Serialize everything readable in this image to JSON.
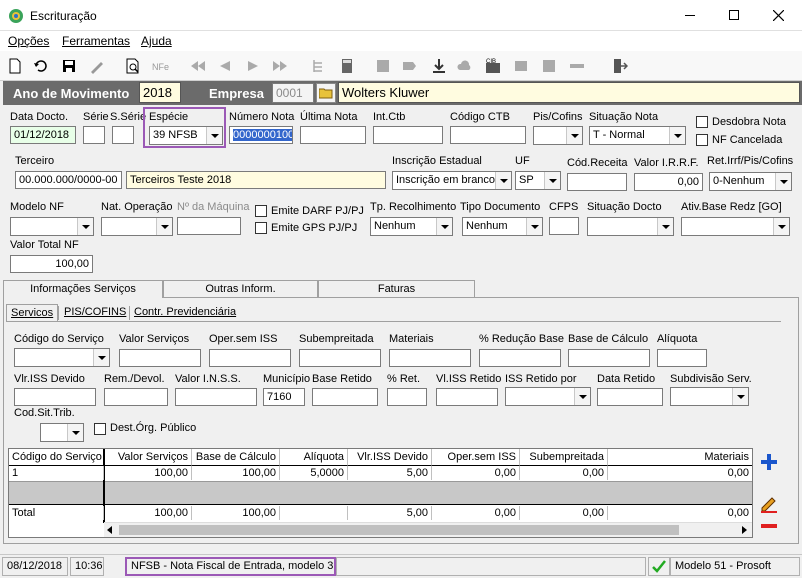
{
  "window": {
    "title": "Escrituração"
  },
  "menu": [
    "Opções",
    "Ferramentas",
    "Ajuda"
  ],
  "header": {
    "ano_label": "Ano de Movimento",
    "ano_value": "2018",
    "empresa_label": "Empresa",
    "empresa_code": "0001",
    "empresa_name": "Wolters Kluwer"
  },
  "row1": {
    "data_docto_label": "Data Docto.",
    "data_docto": "01/12/2018",
    "serie_label": "Série",
    "s_serie_label": "S.Série",
    "especie_label": "Espécie",
    "especie": "39 NFSB",
    "numero_label": "Número Nota",
    "numero": "0000000100",
    "ultima_label": "Última Nota",
    "intctb_label": "Int.Ctb",
    "codctb_label": "Código CTB",
    "piscofins_label": "Pis/Cofins",
    "situacao_label": "Situação Nota",
    "situacao": "T - Normal",
    "desdobra_label": "Desdobra Nota",
    "nfcancelada_label": "NF Cancelada"
  },
  "row2": {
    "terceiro_label": "Terceiro",
    "terceiro_doc": "00.000.000/0000-00",
    "terceiro_nome": "Terceiros Teste 2018",
    "inscricao_label": "Inscrição Estadual",
    "inscricao": "Inscrição em branco",
    "uf_label": "UF",
    "uf": "SP",
    "codreceita_label": "Cód.Receita",
    "irrf_label": "Valor I.R.R.F.",
    "irrf": "0,00",
    "ret_label": "Ret.Irrf/Pis/Cofins",
    "ret": "0-Nenhum"
  },
  "row3": {
    "modelo_label": "Modelo NF",
    "natop_label": "Nat. Operação",
    "maquina_label": "Nº da Máquina",
    "darf_label": "Emite DARF PJ/PJ",
    "gps_label": "Emite GPS PJ/PJ",
    "tprec_label": "Tp. Recolhimento",
    "tprec": "Nenhum",
    "tpdoc_label": "Tipo Documento",
    "tpdoc": "Nenhum",
    "cfps_label": "CFPS",
    "sitdocto_label": "Situação Docto",
    "ativ_label": "Ativ.Base Redz [GO]"
  },
  "row4": {
    "valortotal_label": "Valor Total NF",
    "valortotal": "100,00"
  },
  "tabs": [
    "Informações Serviços",
    "Outras Inform.",
    "Faturas"
  ],
  "subtabs": [
    "Servicos",
    "PIS/COFINS",
    "Contr. Previdenciária"
  ],
  "serv1": {
    "codserv_label": "Código do Serviço",
    "valserv_label": "Valor Serviços",
    "opersem_label": "Oper.sem ISS",
    "subempreitada_label": "Subempreitada",
    "materiais_label": "Materiais",
    "reducao_label": "% Redução Base",
    "basecalc_label": "Base de Cálculo",
    "aliquota_label": "Alíquota"
  },
  "serv2": {
    "vliss_label": "Vlr.ISS Devido",
    "remdevol_label": "Rem./Devol.",
    "valinss_label": "Valor I.N.S.S.",
    "municipio_label": "Município",
    "municipio": "7160",
    "baseretido_label": "Base Retido",
    "pret_label": "% Ret.",
    "vlissret_label": "Vl.ISS Retido",
    "issretpor_label": "ISS Retido por",
    "dataretido_label": "Data Retido",
    "subdiv_label": "Subdivisão Serv."
  },
  "serv3": {
    "codsit_label": "Cod.Sit.Trib.",
    "destorg_label": "Dest.Órg. Público"
  },
  "grid": {
    "headers": [
      "Código do Serviço",
      "Valor Serviços",
      "Base de Cálculo",
      "Alíquota",
      "Vlr.ISS Devido",
      "Oper.sem ISS",
      "Subempreitada",
      "Materiais"
    ],
    "row": [
      "1",
      "100,00",
      "100,00",
      "5,0000",
      "5,00",
      "0,00",
      "0,00",
      "0,00"
    ],
    "total": [
      "Total",
      "100,00",
      "100,00",
      "",
      "5,00",
      "0,00",
      "0,00",
      "0,00"
    ]
  },
  "status": {
    "date": "08/12/2018",
    "time": "10:36",
    "message": "NFSB - Nota Fiscal de Entrada, modelo 3",
    "model": "Modelo 51 - Prosoft"
  },
  "colors": {
    "header_bg": "#6b6b6b",
    "purple_highlight": "#9b59b6",
    "plus_blue": "#1a56cc",
    "minus_red": "#e02020"
  }
}
